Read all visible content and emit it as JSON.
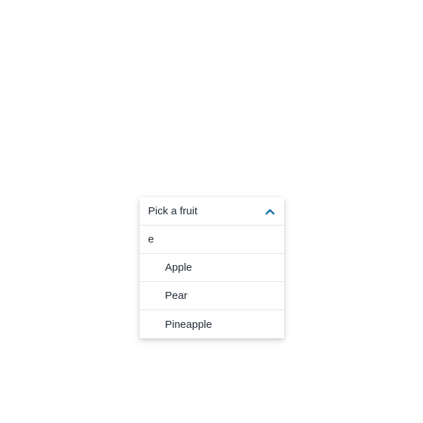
{
  "combobox": {
    "label": "Pick a fruit",
    "expanded": true,
    "accent_color": "#1a6fa8",
    "toggle_icon": "chevron-up-icon",
    "filter_value": "e",
    "options": [
      {
        "label": "Apple"
      },
      {
        "label": "Pear"
      },
      {
        "label": "Pineapple"
      }
    ]
  }
}
